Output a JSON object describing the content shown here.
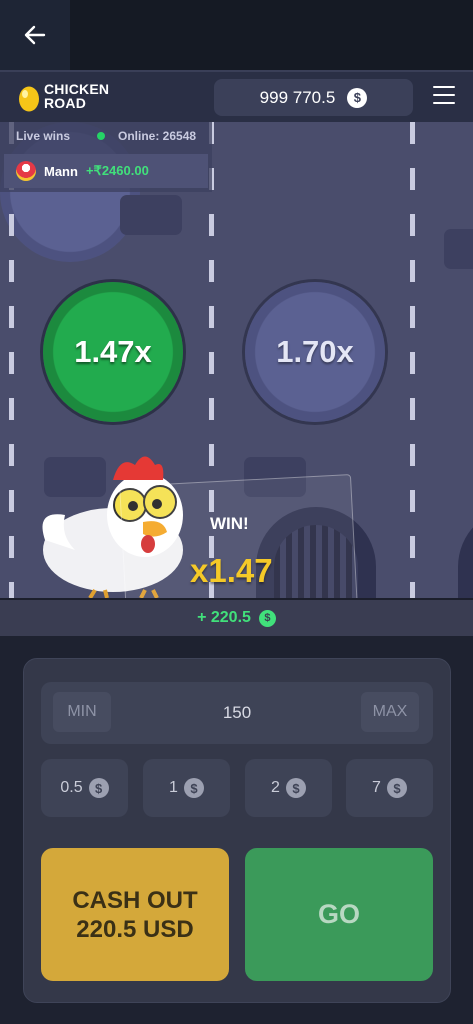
{
  "nav": {
    "back_icon": "arrow-left-icon"
  },
  "header": {
    "logo_line1": "CHICKEN",
    "logo_line2": "ROAD",
    "balance": "999 770.5",
    "currency_symbol": "$",
    "menu_icon": "hamburger-menu-icon"
  },
  "live_wins": {
    "title": "Live wins",
    "online_label": "Online: 26548",
    "latest": {
      "user": "Mann",
      "amount": "+₹2460.00"
    }
  },
  "board": {
    "multipliers": [
      {
        "label": "1.47x",
        "state": "passed",
        "color": "#22ab4e"
      },
      {
        "label": "1.70x",
        "state": "next",
        "color": "#5b6192"
      }
    ],
    "win_label": "WIN!",
    "win_multiplier": "x1.47"
  },
  "gain": {
    "amount": "+ 220.5",
    "currency_symbol": "$"
  },
  "controls": {
    "min_label": "MIN",
    "max_label": "MAX",
    "bet_value": "150",
    "quick_bets": [
      "0.5",
      "1",
      "2",
      "7"
    ],
    "currency_symbol": "$",
    "cashout_line1": "CASH OUT",
    "cashout_line2": "220.5 USD",
    "go_label": "GO"
  },
  "colors": {
    "accent_green": "#41e07b",
    "cashout_gold": "#d4a83a",
    "go_green": "#3b9a5a",
    "win_gold": "#f5c518"
  }
}
